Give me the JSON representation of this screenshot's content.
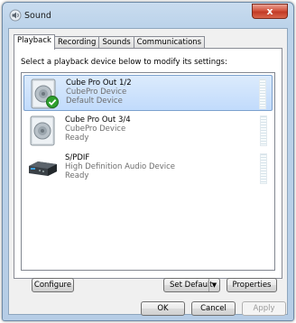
{
  "window": {
    "title": "Sound",
    "close_label": "x"
  },
  "tabs": [
    {
      "label": "Playback",
      "active": true
    },
    {
      "label": "Recording",
      "active": false
    },
    {
      "label": "Sounds",
      "active": false
    },
    {
      "label": "Communications",
      "active": false
    }
  ],
  "instruction": "Select a playback device below to modify its settings:",
  "devices": [
    {
      "name": "Cube Pro Out 1/2",
      "line2": "CubePro Device",
      "line3": "Default Device",
      "selected": true,
      "icon": "speaker-icon",
      "default_badge": "checkmark-icon"
    },
    {
      "name": "Cube Pro Out 3/4",
      "line2": "CubePro Device",
      "line3": "Ready",
      "selected": false,
      "icon": "speaker-icon"
    },
    {
      "name": "S/PDIF",
      "line2": "High Definition Audio Device",
      "line3": "Ready",
      "selected": false,
      "icon": "spdif-device-icon"
    }
  ],
  "buttons": {
    "configure": "Configure",
    "set_default": "Set Default",
    "properties": "Properties",
    "ok": "OK",
    "cancel": "Cancel",
    "apply": "Apply"
  },
  "colors": {
    "selection": "#c1dbfc",
    "close_button": "#c23b26",
    "check_badge": "#2fa02f"
  }
}
